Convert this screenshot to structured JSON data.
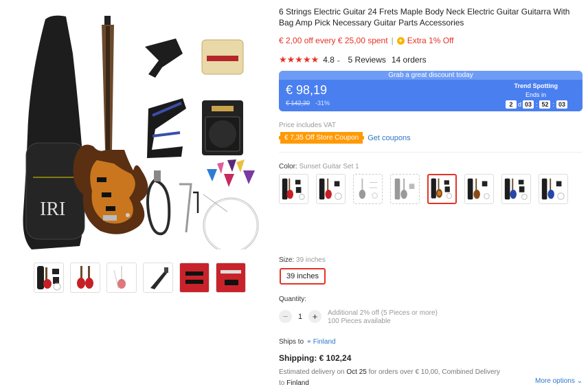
{
  "product": {
    "title": "6 Strings Electric Guitar 24 Frets Maple Body Neck Electric Guitar Guitarra With Bag Amp Pick Necessary Guitar Parts Accessories",
    "promo_spend": "€ 2,00 off every € 25,00 spent",
    "promo_sep": "|",
    "promo_extra": "Extra 1% Off",
    "stars": "★★★★★",
    "rating": "4.8",
    "reviews": "5 Reviews",
    "orders": "14 orders"
  },
  "price": {
    "banner": "Grab a great discount today",
    "current": "€ 98,19",
    "original": "€ 142,30",
    "discount": "-31%",
    "trend": "Trend Spotting",
    "ends_in": "Ends in",
    "days": "2",
    "days_unit": "d",
    "hours": "03",
    "minutes": "52",
    "seconds": "03"
  },
  "vat_note": "Price includes VAT",
  "coupon": {
    "tag": "€ 7,35 Off Store Coupon",
    "link": "Get coupons"
  },
  "color": {
    "label": "Color:",
    "selected": "Sunset Guitar Set 1"
  },
  "size": {
    "label": "Size:",
    "selected": "39 inches",
    "option": "39 inches"
  },
  "quantity": {
    "label": "Quantity:",
    "value": "1",
    "minus": "−",
    "plus": "+",
    "note_1": "Additional 2% off (5 Pieces or more)",
    "note_2": "100 Pieces available"
  },
  "shipping": {
    "ships_to": "Ships to",
    "country": "Finland",
    "cost": "Shipping: € 102,24",
    "est_1": "Estimated delivery on ",
    "date": "Oct 25",
    "est_2": " for orders over € 10,00, Combined Delivery",
    "to": "to ",
    "to_country": "Finland",
    "more": "More options"
  },
  "colors": {
    "accent": "#e43225",
    "link": "#2e76c7",
    "pricebox": "#4a7ff0",
    "coupon": "#ff9a06"
  }
}
